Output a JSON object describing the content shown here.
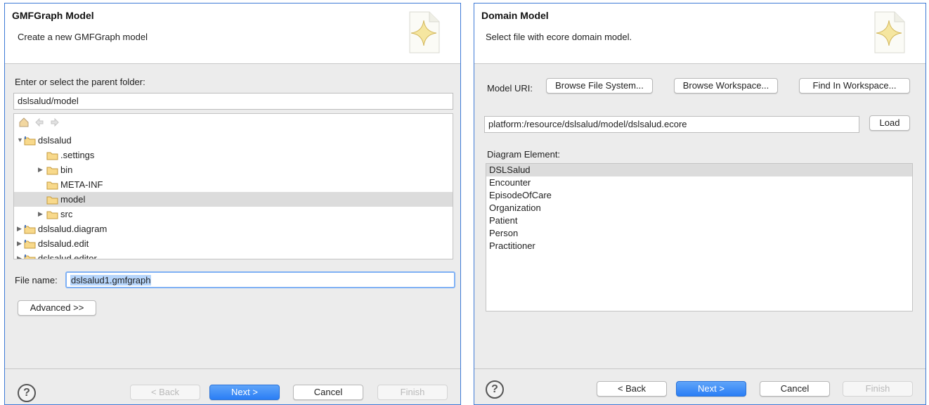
{
  "left": {
    "title": "GMFGraph Model",
    "message": "Create a new GMFGraph model",
    "icon": "wizard-sparkle-icon",
    "folder_prompt": "Enter or select the parent folder:",
    "folder_path": "dslsalud/model",
    "tree_items": [
      {
        "label": "dslsalud",
        "expanded": true
      },
      {
        "label": ".settings"
      },
      {
        "label": "bin"
      },
      {
        "label": "META-INF"
      },
      {
        "label": "model",
        "selected": true
      },
      {
        "label": "src"
      },
      {
        "label": "dslsalud.diagram"
      },
      {
        "label": "dslsalud.edit"
      },
      {
        "label": "dslsalud.editor"
      }
    ],
    "file_name_label": "File name:",
    "file_name": "dslsalud1.gmfgraph",
    "advanced_label": "Advanced >>",
    "buttons": {
      "back": "< Back",
      "next": "Next >",
      "cancel": "Cancel",
      "finish": "Finish"
    }
  },
  "right": {
    "title": "Domain Model",
    "message": "Select file with ecore domain model.",
    "icon": "wizard-sparkle-icon",
    "model_uri_label": "Model URI:",
    "browse_fs": "Browse File System...",
    "browse_ws": "Browse Workspace...",
    "find_ws": "Find In Workspace...",
    "uri": "platform:/resource/dslsalud/model/dslsalud.ecore",
    "load_label": "Load",
    "diagram_element_label": "Diagram Element:",
    "elements": [
      "DSLSalud",
      "Encounter",
      "EpisodeOfCare",
      "Organization",
      "Patient",
      "Person",
      "Practitioner"
    ],
    "selected_element": "DSLSalud",
    "buttons": {
      "back": "< Back",
      "next": "Next >",
      "cancel": "Cancel",
      "finish": "Finish"
    }
  },
  "colors": {
    "accent": "#2a7ef5",
    "selection": "#dcdcdc",
    "panel_border": "#3e7ad6"
  }
}
